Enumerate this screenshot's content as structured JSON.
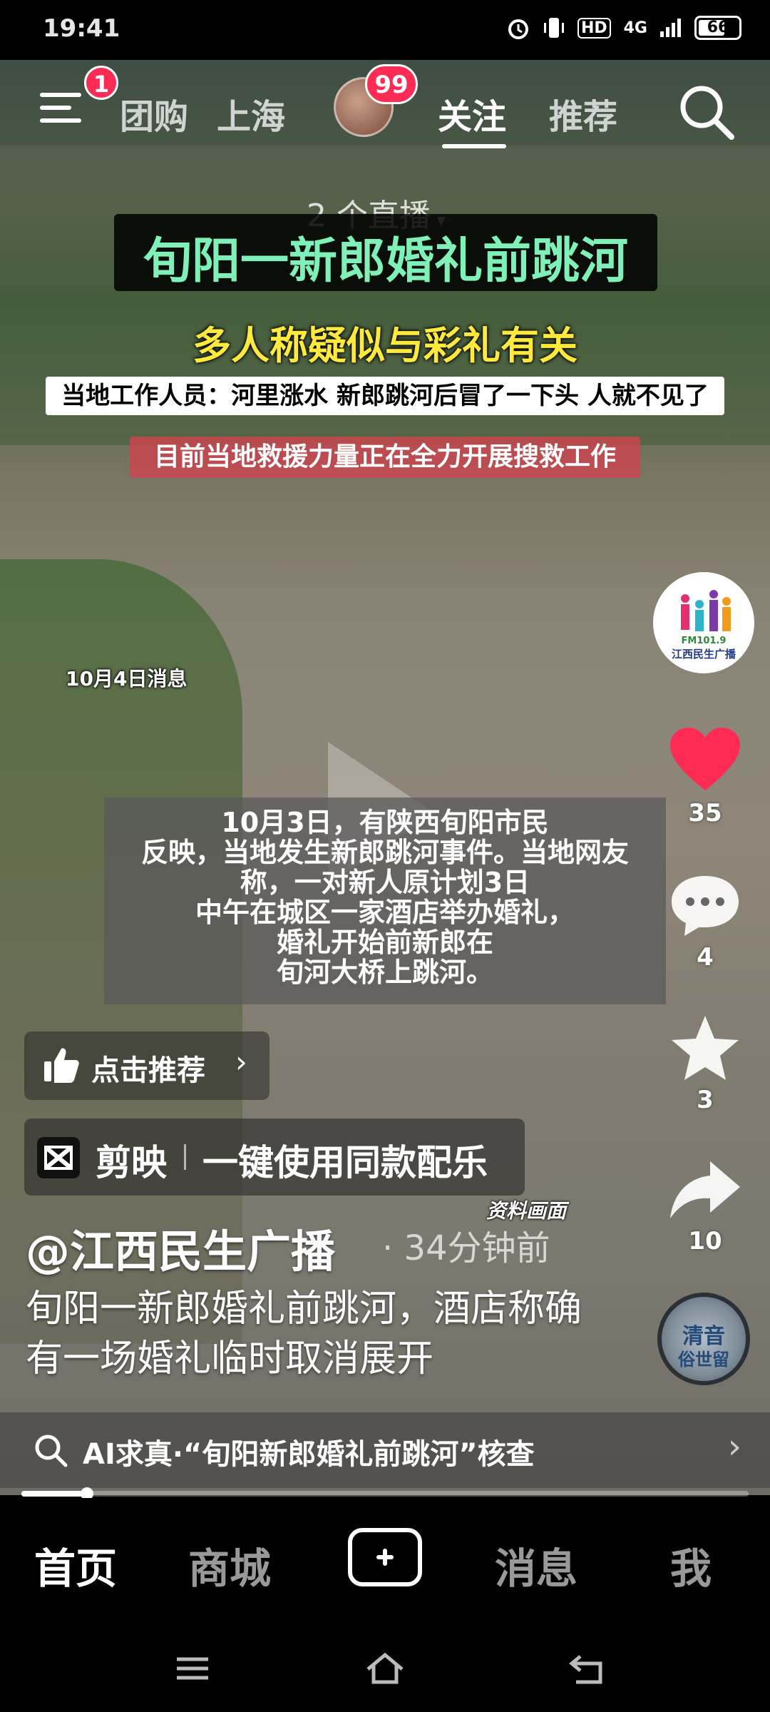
{
  "status_bar": {
    "time": "19:41",
    "icons": [
      "alarm-icon",
      "vibrate-icon",
      "hd-icon",
      "4g-signal-icon"
    ],
    "hd": "HD",
    "network": "4G",
    "battery": "66"
  },
  "top_nav": {
    "menu_badge": "1",
    "items": [
      "团购",
      "上海"
    ],
    "live_badge": "99",
    "tabs": [
      "关注",
      "推荐"
    ],
    "active_tab": "关注"
  },
  "video": {
    "live_count_label": "2 个直播",
    "headline": "旬阳一新郎婚礼前跳河",
    "subheadline": "多人称疑似与彩礼有关",
    "quote": "当地工作人员：河里涨水 新郎跳河后冒了一下头 人就不见了",
    "rescue_note": "目前当地救援力量正在全力开展搜救工作",
    "date_note": "10月4日消息",
    "caption": "10月3日，有陕西旬阳市民\n反映，当地发生新郎跳河事件。当地网友\n称，一对新人原计划3日\n中午在城区一家酒店举办婚礼，\n婚礼开始前新郎在\n旬河大桥上跳河。",
    "source_note": "资料画面"
  },
  "side_rail": {
    "account_avatar": {
      "fm": "FM101.9",
      "label": "江西民生广播"
    },
    "likes": "35",
    "comments": "4",
    "favorites": "3",
    "shares": "10",
    "music_disc": {
      "line1": "清音",
      "line2": "俗世留"
    }
  },
  "recommend": {
    "label": "点击推荐",
    "chevron": "›"
  },
  "capcut": {
    "app_name": "剪映",
    "action": "一键使用同款配乐"
  },
  "post": {
    "author": "@江西民生广播",
    "separator": "·",
    "time_ago": "34分钟前",
    "description": "旬阳一新郎婚礼前跳河，酒店称确有一场婚礼临时取消展开"
  },
  "ai_search": {
    "label": "AI求真·“旬阳新郎婚礼前跳河”核查",
    "chevron": "›"
  },
  "playback": {
    "progress": 0.09
  },
  "bottom_nav": {
    "tabs": [
      "首页",
      "商城",
      "消息",
      "我"
    ],
    "active": "首页"
  },
  "colors": {
    "accent_red": "#fe2c55",
    "headline_green": "#7ef0b8",
    "sub_yellow": "#ffe93d"
  }
}
